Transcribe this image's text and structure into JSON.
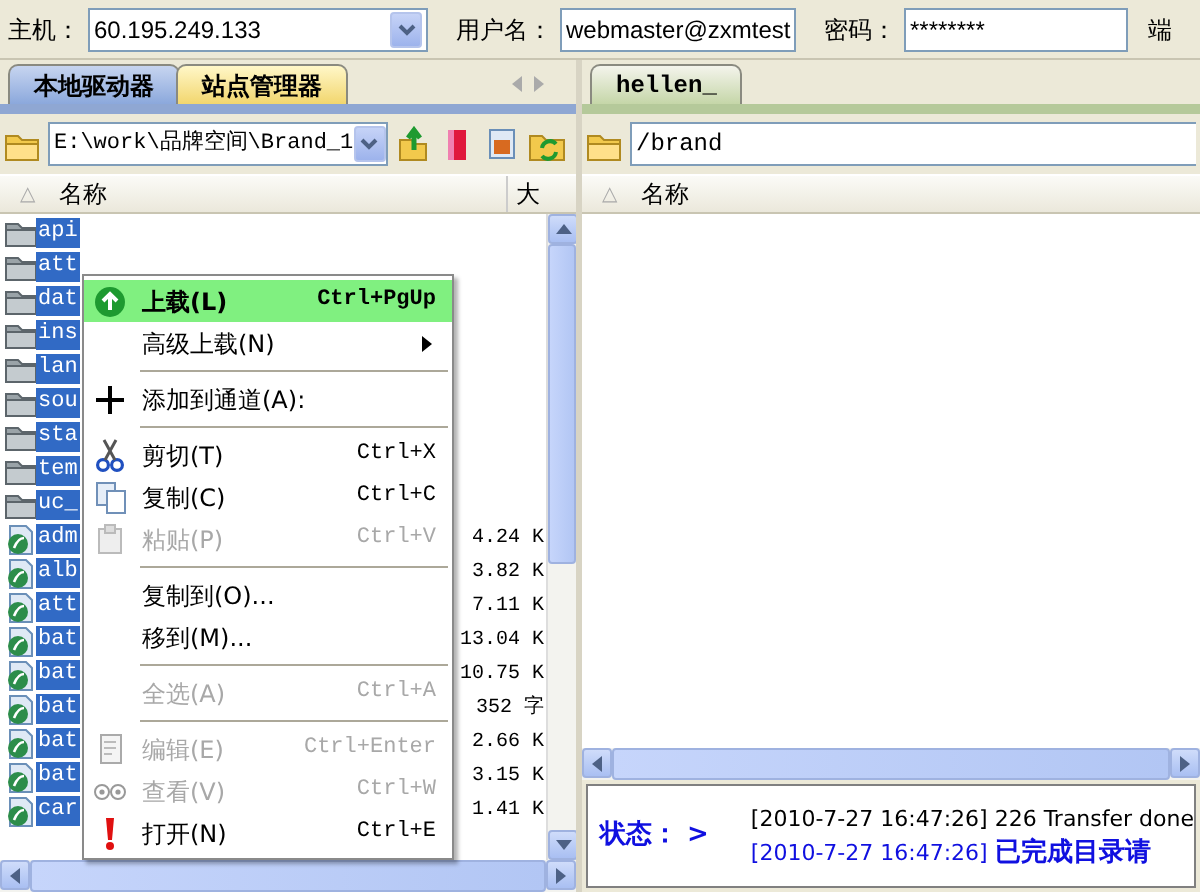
{
  "connection_bar": {
    "fields": [
      {
        "label": "主机：",
        "value": "60.195.249.133",
        "dropdown": true
      },
      {
        "label": "用户名：",
        "value": "webmaster@zxmtest",
        "dropdown": false
      },
      {
        "label": "密码：",
        "value": "********",
        "dropdown": false
      }
    ],
    "cut_label": "端"
  },
  "local_panel": {
    "tabs": [
      {
        "label": "本地驱动器",
        "selected": true
      },
      {
        "label": "站点管理器",
        "selected": false
      }
    ],
    "path": "E:\\work\\品牌空间\\Brand_1",
    "sort_mark": "△",
    "columns": [
      "名称",
      "大"
    ],
    "files": [
      {
        "name": "api",
        "kind": "folder",
        "selected": true
      },
      {
        "name": "att",
        "kind": "folder",
        "selected": true
      },
      {
        "name": "dat",
        "kind": "folder",
        "selected": true
      },
      {
        "name": "ins",
        "kind": "folder",
        "selected": true
      },
      {
        "name": "lan",
        "kind": "folder",
        "selected": true
      },
      {
        "name": "sou",
        "kind": "folder",
        "selected": true
      },
      {
        "name": "sta",
        "kind": "folder",
        "selected": true
      },
      {
        "name": "tem",
        "kind": "folder",
        "selected": true
      },
      {
        "name": "uc_",
        "kind": "folder",
        "selected": true
      },
      {
        "name": "adm",
        "kind": "file",
        "size": "4.24 K",
        "selected": true
      },
      {
        "name": "alb",
        "kind": "file",
        "size": "3.82 K",
        "selected": true
      },
      {
        "name": "att",
        "kind": "file",
        "size": "7.11 K",
        "selected": true
      },
      {
        "name": "bat",
        "kind": "file",
        "size": "13.04 K",
        "selected": true
      },
      {
        "name": "bat",
        "kind": "file",
        "size": "10.75 K",
        "selected": true
      },
      {
        "name": "bat",
        "kind": "file",
        "size": "352 字",
        "selected": true
      },
      {
        "name": "bat",
        "kind": "file",
        "size": "2.66 K",
        "selected": true
      },
      {
        "name": "bat",
        "kind": "file",
        "size": "3.15 K",
        "selected": true
      },
      {
        "name": "car",
        "kind": "file",
        "size": "1.41 K",
        "selected": true
      }
    ]
  },
  "remote_panel": {
    "tabs": [
      {
        "label": "hellen_",
        "selected": true
      }
    ],
    "path": "/brand",
    "sort_mark": "△",
    "columns": [
      "名称"
    ]
  },
  "log": {
    "status_label": "状态： >",
    "lines": [
      {
        "time": "[2010-7-27 16:47:26]",
        "message": "226 Transfer done",
        "kind": "server"
      },
      {
        "time": "[2010-7-27 16:47:26]",
        "message": "已完成目录请",
        "kind": "status"
      }
    ]
  },
  "context_menu": {
    "items": [
      {
        "kind": "item",
        "label": "上载(L)",
        "shortcut": "Ctrl+PgUp",
        "highlighted": true,
        "disabled": false,
        "submenu": false
      },
      {
        "kind": "item",
        "label": "高级上载(N)",
        "highlighted": false,
        "disabled": false,
        "submenu": true
      },
      {
        "kind": "separator"
      },
      {
        "kind": "item",
        "label": "添加到通道(A):",
        "highlighted": false,
        "disabled": false,
        "submenu": false
      },
      {
        "kind": "separator"
      },
      {
        "kind": "item",
        "label": "剪切(T)",
        "shortcut": "Ctrl+X",
        "highlighted": false,
        "disabled": false,
        "submenu": false
      },
      {
        "kind": "item",
        "label": "复制(C)",
        "shortcut": "Ctrl+C",
        "highlighted": false,
        "disabled": false,
        "submenu": false
      },
      {
        "kind": "item",
        "label": "粘贴(P)",
        "shortcut": "Ctrl+V",
        "highlighted": false,
        "disabled": true,
        "submenu": false
      },
      {
        "kind": "separator"
      },
      {
        "kind": "item",
        "label": "复制到(O)...",
        "highlighted": false,
        "disabled": false,
        "submenu": false
      },
      {
        "kind": "item",
        "label": "移到(M)...",
        "highlighted": false,
        "disabled": false,
        "submenu": false
      },
      {
        "kind": "separator"
      },
      {
        "kind": "item",
        "label": "全选(A)",
        "shortcut": "Ctrl+A",
        "highlighted": false,
        "disabled": true,
        "submenu": false
      },
      {
        "kind": "separator"
      },
      {
        "kind": "item",
        "label": "编辑(E)",
        "shortcut": "Ctrl+Enter",
        "highlighted": false,
        "disabled": true,
        "submenu": false
      },
      {
        "kind": "item",
        "label": "查看(V)",
        "shortcut": "Ctrl+W",
        "highlighted": false,
        "disabled": true,
        "submenu": false
      },
      {
        "kind": "item",
        "label": "打开(N)",
        "shortcut": "Ctrl+E",
        "highlighted": false,
        "disabled": false,
        "submenu": false
      }
    ]
  }
}
